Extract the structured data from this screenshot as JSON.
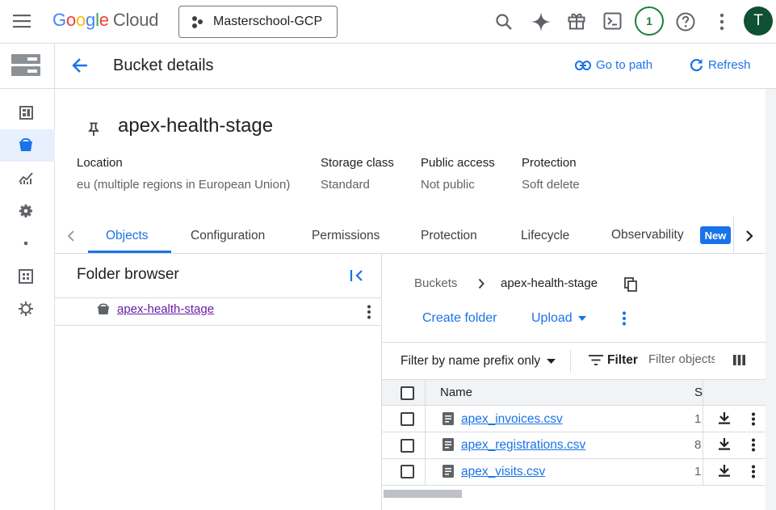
{
  "topbar": {
    "logo_letters": [
      "G",
      "o",
      "o",
      "g",
      "l",
      "e"
    ],
    "logo_product": "Cloud",
    "project_name": "Masterschool-GCP",
    "notification_count": "1",
    "avatar_initial": "T",
    "icons": [
      "menu-icon",
      "search-icon",
      "gemini-sparkle-icon",
      "gift-icon",
      "cloud-shell-icon",
      "help-icon",
      "more-vert-icon"
    ]
  },
  "header": {
    "title": "Bucket details",
    "go_to_path": "Go to path",
    "refresh": "Refresh"
  },
  "bucket": {
    "name": "apex-health-stage",
    "details": [
      {
        "label": "Location",
        "value": "eu (multiple regions in European Union)"
      },
      {
        "label": "Storage class",
        "value": "Standard"
      },
      {
        "label": "Public access",
        "value": "Not public"
      },
      {
        "label": "Protection",
        "value": "Soft delete"
      }
    ]
  },
  "tabs": [
    {
      "label": "Objects",
      "active": true
    },
    {
      "label": "Configuration"
    },
    {
      "label": "Permissions"
    },
    {
      "label": "Protection"
    },
    {
      "label": "Lifecycle"
    },
    {
      "label": "Observability",
      "badge": "New"
    }
  ],
  "folder_browser": {
    "title": "Folder browser",
    "root": "apex-health-stage"
  },
  "objects": {
    "breadcrumb_root": "Buckets",
    "breadcrumb_current": "apex-health-stage",
    "create_folder": "Create folder",
    "upload": "Upload",
    "filter_mode": "Filter by name prefix only",
    "filter_label": "Filter",
    "filter_placeholder": "Filter objects and folders",
    "columns": [
      "Name",
      "S"
    ],
    "rows": [
      {
        "name": "apex_invoices.csv",
        "size": "1"
      },
      {
        "name": "apex_registrations.csv",
        "size": "8"
      },
      {
        "name": "apex_visits.csv",
        "size": "1"
      }
    ]
  },
  "colors": {
    "accent": "#1a73e8",
    "border": "#dadce0",
    "avatar": "#0f5132",
    "badge_green": "#188038"
  }
}
